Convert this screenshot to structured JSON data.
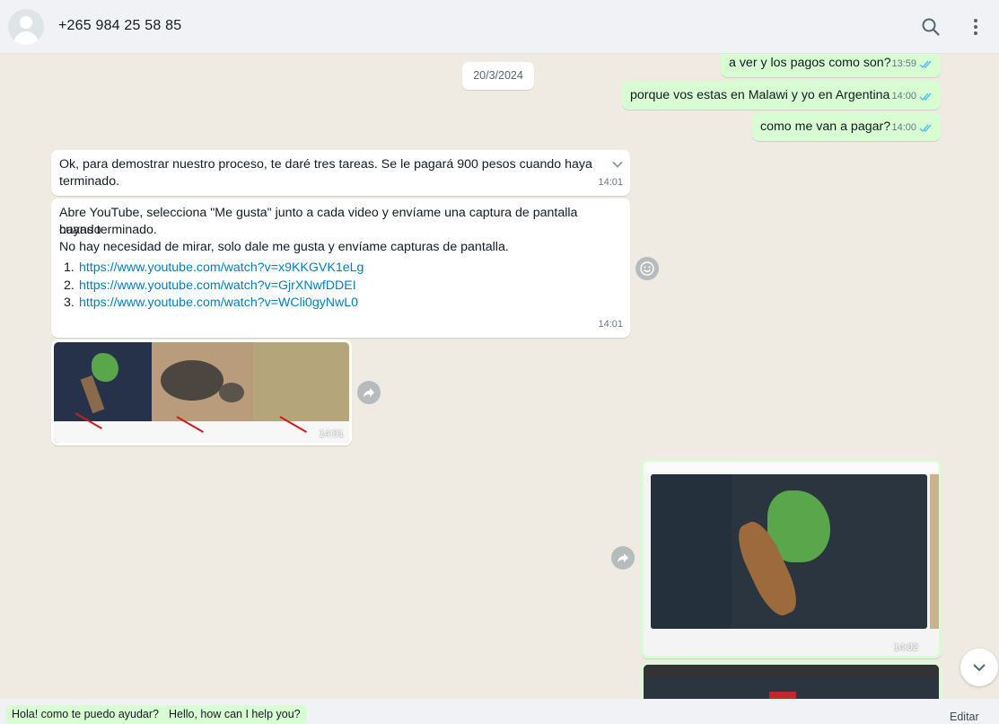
{
  "header": {
    "contact_name": "+265 984 25 58 85",
    "icons": [
      "avatar-placeholder",
      "search-icon",
      "menu-icon"
    ]
  },
  "date_chip": "20/3/2024",
  "messages": [
    {
      "direction": "out",
      "text": "a ver y los pagos como son?",
      "time": "13:59",
      "status": "read"
    },
    {
      "direction": "out",
      "text": "porque vos estas en Malawi y yo en Argentina",
      "time": "14:00",
      "status": "read"
    },
    {
      "direction": "out",
      "text": "como me van a pagar?",
      "time": "14:00",
      "status": "read"
    },
    {
      "direction": "in",
      "line1": "Ok, para demostrar nuestro proceso, te daré tres tareas. Se le pagará 900 pesos cuando haya",
      "line2": "terminado.",
      "time": "14:01"
    },
    {
      "direction": "in",
      "line1": "Abre YouTube, selecciona \"Me gusta\" junto a cada video y envíame una captura de pantalla cuando",
      "line2": "hayas terminado.",
      "line3": "No hay necesidad de mirar, solo dale me gusta y envíame capturas de pantalla.",
      "links": [
        {
          "num": "1.",
          "url": "https://www.youtube.com/watch?v=x9KKGVK1eLg"
        },
        {
          "num": "2.",
          "url": "https://www.youtube.com/watch?v=GjrXNwfDDEI"
        },
        {
          "num": "3.",
          "url": "https://www.youtube.com/watch?v=WCli0gyNwL0"
        }
      ],
      "time": "14:01"
    },
    {
      "direction": "in",
      "type": "image",
      "time": "14:01"
    },
    {
      "direction": "out",
      "type": "image",
      "time": "14:02",
      "status": "read"
    }
  ],
  "quick_replies": [
    "Hola! como te puedo ayudar?",
    "Hello, how can I help you?"
  ],
  "edit_label": "Editar",
  "colors": {
    "outgoing": "#d9fdd3",
    "incoming": "#ffffff",
    "link": "#027eb5",
    "read_ticks": "#53bdeb",
    "background": "#efeae2"
  }
}
